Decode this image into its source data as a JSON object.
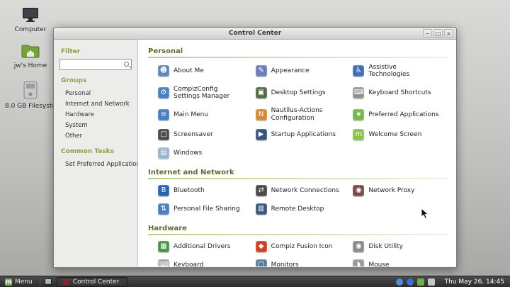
{
  "desktop": {
    "icons": [
      {
        "label": "Computer"
      },
      {
        "label": "jw's Home"
      },
      {
        "label": "8.0 GB Filesyste"
      }
    ]
  },
  "window": {
    "title": "Control Center",
    "controls": {
      "minimize": "−",
      "maximize": "□",
      "close": "×"
    },
    "sidebar": {
      "filter_label": "Filter",
      "search_value": "",
      "groups_label": "Groups",
      "groups": [
        "Personal",
        "Internet and Network",
        "Hardware",
        "System",
        "Other"
      ],
      "common_tasks_label": "Common Tasks",
      "tasks": [
        "Set Preferred Applications"
      ]
    },
    "sections": [
      {
        "title": "Personal",
        "items": [
          {
            "label": "About Me",
            "glyph": "☻",
            "color": "#5b87b8"
          },
          {
            "label": "Appearance",
            "glyph": "✎",
            "color": "#6b7fb5"
          },
          {
            "label": "Assistive Technologies",
            "glyph": "♿",
            "color": "#3f6fb5"
          },
          {
            "label": "CompizConfig Settings Manager",
            "glyph": "⚙",
            "color": "#4a7fc1"
          },
          {
            "label": "Desktop Settings",
            "glyph": "▣",
            "color": "#4e6b3f"
          },
          {
            "label": "Keyboard Shortcuts",
            "glyph": "⌨",
            "color": "#8f8f8f"
          },
          {
            "label": "Main Menu",
            "glyph": "≡",
            "color": "#4a7fc1"
          },
          {
            "label": "Nautilus-Actions Configuration",
            "glyph": "N",
            "color": "#d08a3a"
          },
          {
            "label": "Preferred Applications",
            "glyph": "★",
            "color": "#7ab648"
          },
          {
            "label": "Screensaver",
            "glyph": "□",
            "color": "#4a4a4a"
          },
          {
            "label": "Startup Applications",
            "glyph": "▶",
            "color": "#35567a"
          },
          {
            "label": "Welcome Screen",
            "glyph": "m",
            "color": "#8bc34a"
          },
          {
            "label": "Windows",
            "glyph": "▤",
            "color": "#9ab3c9"
          }
        ]
      },
      {
        "title": "Internet and Network",
        "items": [
          {
            "label": "Bluetooth",
            "glyph": "B",
            "color": "#2f5fb5"
          },
          {
            "label": "Network Connections",
            "glyph": "⇄",
            "color": "#4a4a4a"
          },
          {
            "label": "Network Proxy",
            "glyph": "◉",
            "color": "#7a4a4a"
          },
          {
            "label": "Personal File Sharing",
            "glyph": "⇅",
            "color": "#4a7fc1"
          },
          {
            "label": "Remote Desktop",
            "glyph": "▥",
            "color": "#35567a"
          }
        ]
      },
      {
        "title": "Hardware",
        "items": [
          {
            "label": "Additional Drivers",
            "glyph": "▦",
            "color": "#4a8f4a"
          },
          {
            "label": "Compiz Fusion Icon",
            "glyph": "◆",
            "color": "#d04020"
          },
          {
            "label": "Disk Utility",
            "glyph": "◉",
            "color": "#8a8a8a"
          },
          {
            "label": "Keyboard",
            "glyph": "⌨",
            "color": "#9a9a9a"
          },
          {
            "label": "Monitors",
            "glyph": "□",
            "color": "#5a7a9a"
          },
          {
            "label": "Mouse",
            "glyph": "◗",
            "color": "#9a9a9a"
          },
          {
            "label": "",
            "glyph": "⚙",
            "color": "#7a8a5a"
          },
          {
            "label": "",
            "glyph": "⚙",
            "color": "#888888"
          },
          {
            "label": "",
            "glyph": "⚙",
            "color": "#b5893a"
          }
        ]
      }
    ]
  },
  "taskbar": {
    "menu_logo_glyph": "m",
    "menu_label": "Menu",
    "window_button": "Control Center",
    "clock": "Thu May 26, 14:45",
    "tray": [
      {
        "name": "update-manager",
        "color": "#4a90d9",
        "shape": "round"
      },
      {
        "name": "bluetooth",
        "color": "#3b6fd4",
        "shape": "round"
      },
      {
        "name": "battery",
        "color": "#6fae3f",
        "shape": "square"
      },
      {
        "name": "volume",
        "color": "#c8c8c8",
        "shape": "square"
      }
    ]
  }
}
